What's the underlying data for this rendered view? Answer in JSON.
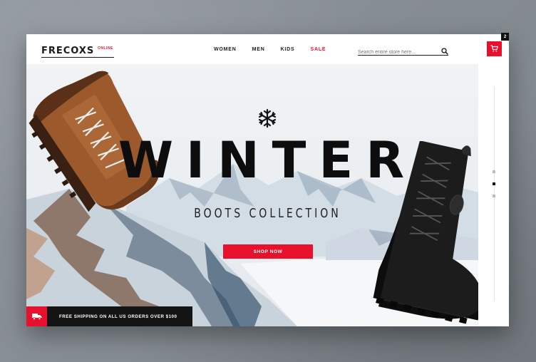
{
  "brand": {
    "name": "FRECOXS",
    "tag": "ONLINE"
  },
  "nav": [
    {
      "label": "WOMEN"
    },
    {
      "label": "MEN"
    },
    {
      "label": "KIDS"
    },
    {
      "label": "SALE"
    }
  ],
  "search": {
    "placeholder": "Search entire store here..."
  },
  "cart": {
    "count": "2"
  },
  "hero": {
    "title": "WINTER",
    "subtitle": "BOOTS COLLECTION",
    "cta": "SHOP NOW"
  },
  "shipping": {
    "text": "FREE SHIPPING ON ALL US ORDERS OVER $100"
  },
  "colors": {
    "accent": "#e8112d",
    "dark": "#141414"
  },
  "icons": [
    "search-icon",
    "cart-icon",
    "snowflake-icon",
    "truck-icon"
  ]
}
